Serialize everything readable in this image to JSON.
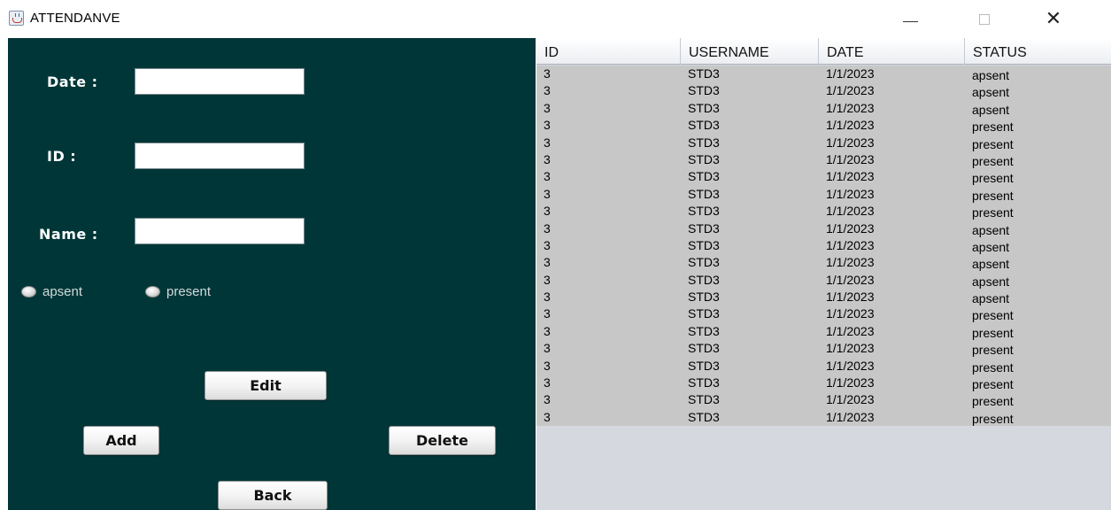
{
  "window": {
    "title": "ATTENDANVE",
    "icon": "java-cup-icon",
    "controls": {
      "minimize": "minimize-icon",
      "maximize": "maximize-icon",
      "close": "✕"
    }
  },
  "colors": {
    "panel_bg": "#003638",
    "table_row_bg": "#c7c7c7",
    "table_empty_bg": "#d6d8df"
  },
  "form": {
    "date_label": "Date :",
    "date_value": "",
    "id_label": "ID :",
    "id_value": "",
    "name_label": "Name :",
    "name_value": "",
    "radios": [
      {
        "label": "apsent",
        "checked": false
      },
      {
        "label": "present",
        "checked": false
      }
    ]
  },
  "buttons": {
    "edit": "Edit",
    "add": "Add",
    "delete": "Delete",
    "back": "Back"
  },
  "table": {
    "columns": [
      "ID",
      "USERNAME",
      "DATE",
      "STATUS"
    ],
    "rows": [
      [
        "3",
        "STD3",
        "1/1/2023",
        "apsent"
      ],
      [
        "3",
        "STD3",
        "1/1/2023",
        "apsent"
      ],
      [
        "3",
        "STD3",
        "1/1/2023",
        "apsent"
      ],
      [
        "3",
        "STD3",
        "1/1/2023",
        "present"
      ],
      [
        "3",
        "STD3",
        "1/1/2023",
        "present"
      ],
      [
        "3",
        "STD3",
        "1/1/2023",
        "present"
      ],
      [
        "3",
        "STD3",
        "1/1/2023",
        "present"
      ],
      [
        "3",
        "STD3",
        "1/1/2023",
        "present"
      ],
      [
        "3",
        "STD3",
        "1/1/2023",
        "present"
      ],
      [
        "3",
        "STD3",
        "1/1/2023",
        "apsent"
      ],
      [
        "3",
        "STD3",
        "1/1/2023",
        "apsent"
      ],
      [
        "3",
        "STD3",
        "1/1/2023",
        "apsent"
      ],
      [
        "3",
        "STD3",
        "1/1/2023",
        "apsent"
      ],
      [
        "3",
        "STD3",
        "1/1/2023",
        "apsent"
      ],
      [
        "3",
        "STD3",
        "1/1/2023",
        "present"
      ],
      [
        "3",
        "STD3",
        "1/1/2023",
        "present"
      ],
      [
        "3",
        "STD3",
        "1/1/2023",
        "present"
      ],
      [
        "3",
        "STD3",
        "1/1/2023",
        "present"
      ],
      [
        "3",
        "STD3",
        "1/1/2023",
        "present"
      ],
      [
        "3",
        "STD3",
        "1/1/2023",
        "present"
      ],
      [
        "3",
        "STD3",
        "1/1/2023",
        "present"
      ]
    ]
  }
}
